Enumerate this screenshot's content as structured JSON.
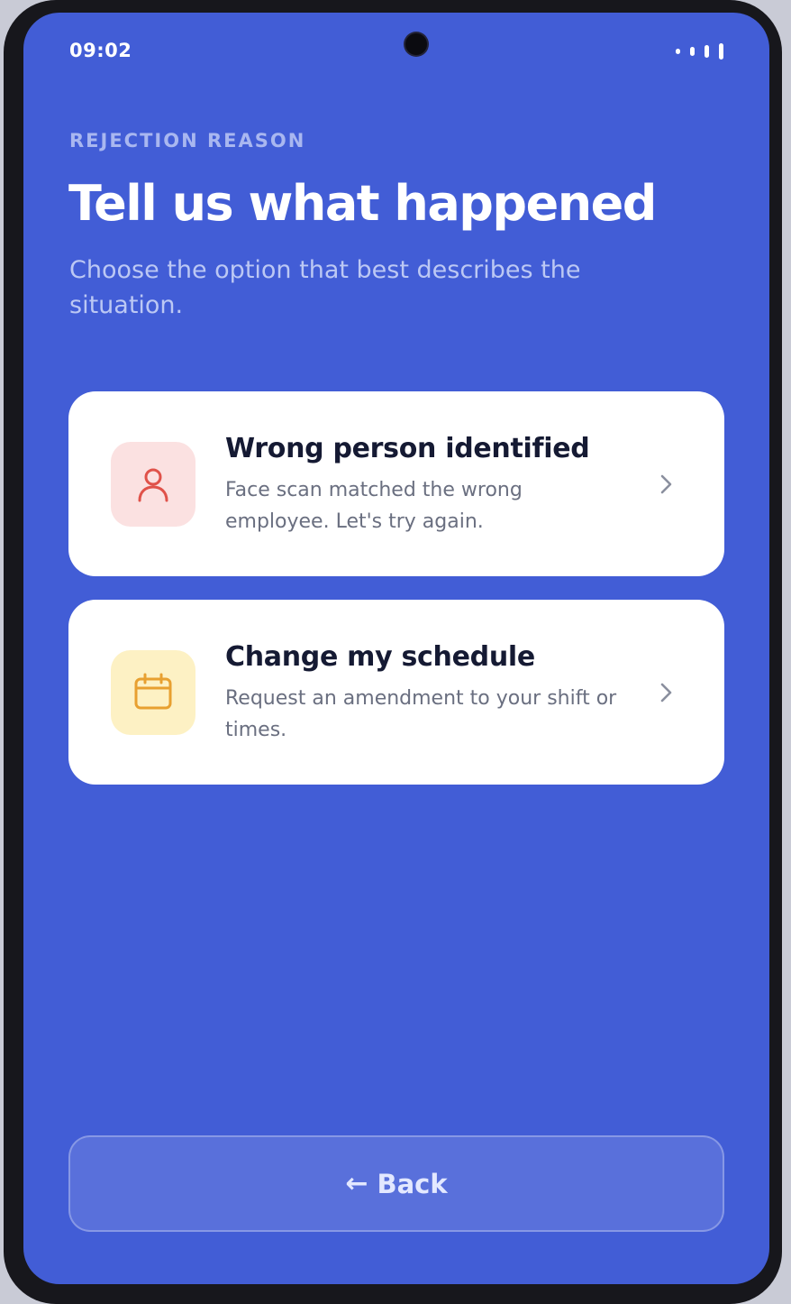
{
  "status_bar": {
    "time": "09:02"
  },
  "header": {
    "eyebrow": "REJECTION REASON",
    "title": "Tell us what happened",
    "subtitle": "Choose the option that best describes the situation."
  },
  "options": [
    {
      "title": "Wrong person identified",
      "description": "Face scan matched the wrong employee. Let's try again.",
      "icon": "user-icon",
      "icon_bg": "#fbe1e1",
      "icon_color": "#e0524a"
    },
    {
      "title": "Change my schedule",
      "description": "Request an amendment to your shift or times.",
      "icon": "calendar-icon",
      "icon_bg": "#fdf1c4",
      "icon_color": "#e8a030"
    }
  ],
  "footer": {
    "back_arrow": "←",
    "back_label": "Back"
  },
  "colors": {
    "screen_bg": "#425dd6",
    "card_bg": "#ffffff",
    "title_text": "#151a33"
  }
}
